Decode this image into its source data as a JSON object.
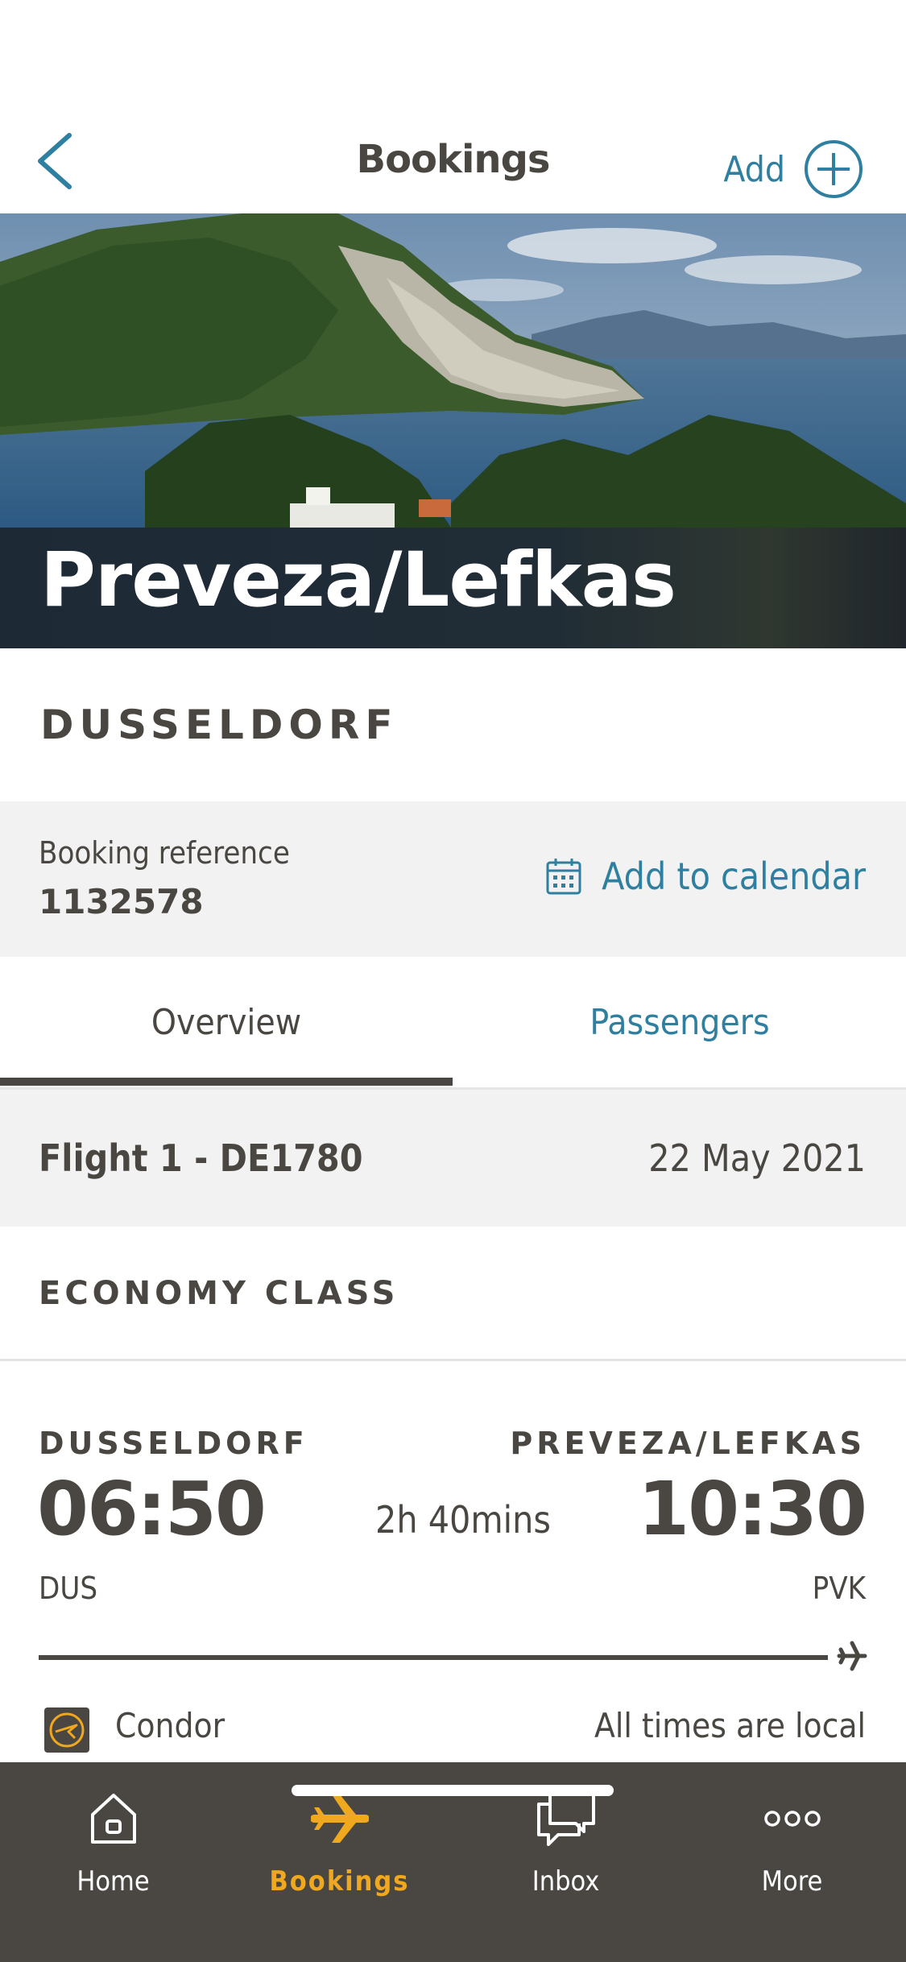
{
  "header": {
    "title": "Bookings",
    "add_label": "Add"
  },
  "hero": {
    "destination": "Preveza/Lefkas"
  },
  "origin": "DUSSELDORF",
  "booking": {
    "reference_label": "Booking reference",
    "reference_value": "1132578",
    "calendar_label": "Add to calendar"
  },
  "tabs": [
    {
      "label": "Overview",
      "active": true
    },
    {
      "label": "Passengers",
      "active": false
    }
  ],
  "flight": {
    "title": "Flight 1 - DE1780",
    "date": "22 May 2021",
    "cabin_class": "ECONOMY CLASS",
    "departure": {
      "city": "DUSSELDORF",
      "time": "06:50",
      "code": "DUS"
    },
    "arrival": {
      "city": "PREVEZA/LEFKAS",
      "time": "10:30",
      "code": "PVK"
    },
    "duration": "2h 40mins",
    "airline": "Condor",
    "time_note": "All times are local"
  },
  "bottom_nav": [
    {
      "label": "Home",
      "icon": "home-icon",
      "active": false
    },
    {
      "label": "Bookings",
      "icon": "plane-icon",
      "active": true
    },
    {
      "label": "Inbox",
      "icon": "chat-icon",
      "active": false
    },
    {
      "label": "More",
      "icon": "more-dots-icon",
      "active": false
    }
  ],
  "colors": {
    "accent_blue": "#2f7fa0",
    "text_dark": "#4a4742",
    "active_orange": "#f0a81e",
    "tabbar_bg": "#4a4742",
    "band_bg": "#f2f2f2"
  }
}
